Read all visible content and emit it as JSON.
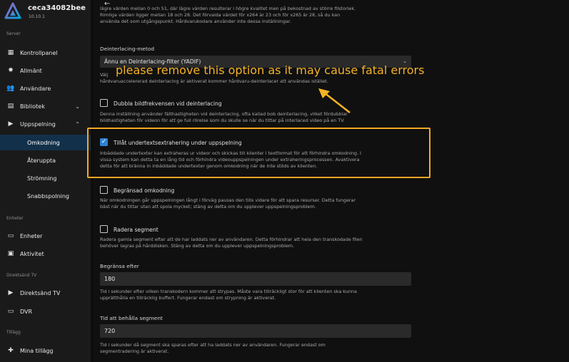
{
  "app": {
    "server_name": "ceca34082bee",
    "version": "10.10.1"
  },
  "sidebar": {
    "server_section": "Server",
    "items": [
      {
        "label": "Kontrollpanel",
        "icon": "dashboard-icon"
      },
      {
        "label": "Allmänt",
        "icon": "gear-icon"
      },
      {
        "label": "Användare",
        "icon": "users-icon"
      },
      {
        "label": "Bibliotek",
        "icon": "library-icon"
      },
      {
        "label": "Uppspelning",
        "icon": "play-icon"
      }
    ],
    "playback_sub": [
      {
        "label": "Omkodning"
      },
      {
        "label": "Återuppta"
      },
      {
        "label": "Strömning"
      },
      {
        "label": "Snabbspolning"
      }
    ],
    "devices_section": "Enheter",
    "devices_items": [
      {
        "label": "Enheter",
        "icon": "devices-icon"
      },
      {
        "label": "Aktivitet",
        "icon": "activity-icon"
      }
    ],
    "livetv_section": "Direktsänd TV",
    "livetv_items": [
      {
        "label": "Direktsänd TV",
        "icon": "tv-icon"
      },
      {
        "label": "DVR",
        "icon": "dvr-icon"
      }
    ],
    "plugins_section": "Tillägg",
    "plugins_items": [
      {
        "label": "Mina tillägg",
        "icon": "puzzle-icon"
      }
    ]
  },
  "main": {
    "top_text": [
      "lägre värden mellan 0 och 51, där lägre värden resulterar i högre kvalitet men på bekostnad av större filstorlek.",
      "Rimliga värden ligger mellan 18 och 28. Det förvalda värdet för x264 är 23 och för x265 är 28, så du kan",
      "använda det som utgångspunkt. Hårdvarukodare använder inte dessa inställningar."
    ],
    "deinterlace": {
      "label": "Deinterlacing-metod",
      "value": "Ännu en Deinterlacing-filter (YADIF)",
      "help": [
        "Välj",
        "hårdvaruaccelererad deinterlacing är aktiverat kommer hårdvaru-deinterlacer att användas istället."
      ]
    },
    "double_rate": {
      "label": "Dubbla bildfrekvensen vid deinterlacing",
      "help": [
        "Denna inställning använder fälthastigheten vid deinterlacing, ofta kallad bob deinterlacing, vilket fördubblar",
        "bildhastigheten för videon för att ge full rörelse som du skulle se när du tittar på interlaced video på en TV."
      ]
    },
    "subtitle_extraction": {
      "label": "Tillåt undertextsextrahering under uppspelning",
      "checked": true,
      "help": [
        "Inbäddade undertexter kan extraheras ur videor och skickas till klienter i textformat för att förhindra omkodning. I",
        "vissa system kan detta ta en lång tid och förhindra videouppspelningen under extraheringsprocessen. Avaktivera",
        "detta för att bränna in inbäddade undertexter genom omkodning när de inte stöds av klienten."
      ]
    },
    "throttle": {
      "label": "Begränsad omkodning",
      "help": [
        "När omkodningen går uppspelningen långt i förväg pausas den tills vidare för att spara resurser. Detta fungerar",
        "bäst när du tittar utan att spola mycket; stäng av detta om du upplever uppspelningsproblem."
      ]
    },
    "delete_segments": {
      "label": "Radera segment",
      "help": [
        "Radera gamla segment efter att de har laddats ner av användaren. Detta förhindrar att hela den transkodade filen",
        "behöver lagras på hårddisken. Stäng av detta om du upplever uppspelningsproblem."
      ]
    },
    "throttle_after": {
      "label": "Begränsa efter",
      "value": "180",
      "help": [
        "Tid i sekunder efter vilken transkodern kommer att strypas. Måste vara tillräckligt stor för att klienten ska kunna",
        "upprätthålla en tillräcklig buffert. Fungerar endast om strypning är aktiverat."
      ]
    },
    "segment_keep": {
      "label": "Tid att behålla segment",
      "value": "720",
      "help": [
        "Tid i sekunder då segment ska sparas efter att ha laddats ner av användaren. Fungerar endast om",
        "segmentradering är aktiverat."
      ]
    }
  },
  "annotation": {
    "text": "please remove this option as it may cause fatal errors",
    "color": "#f5b324"
  },
  "colors": {
    "accent": "#2d83d2",
    "active_bg": "#13304a",
    "highlight": "#f5a623"
  }
}
